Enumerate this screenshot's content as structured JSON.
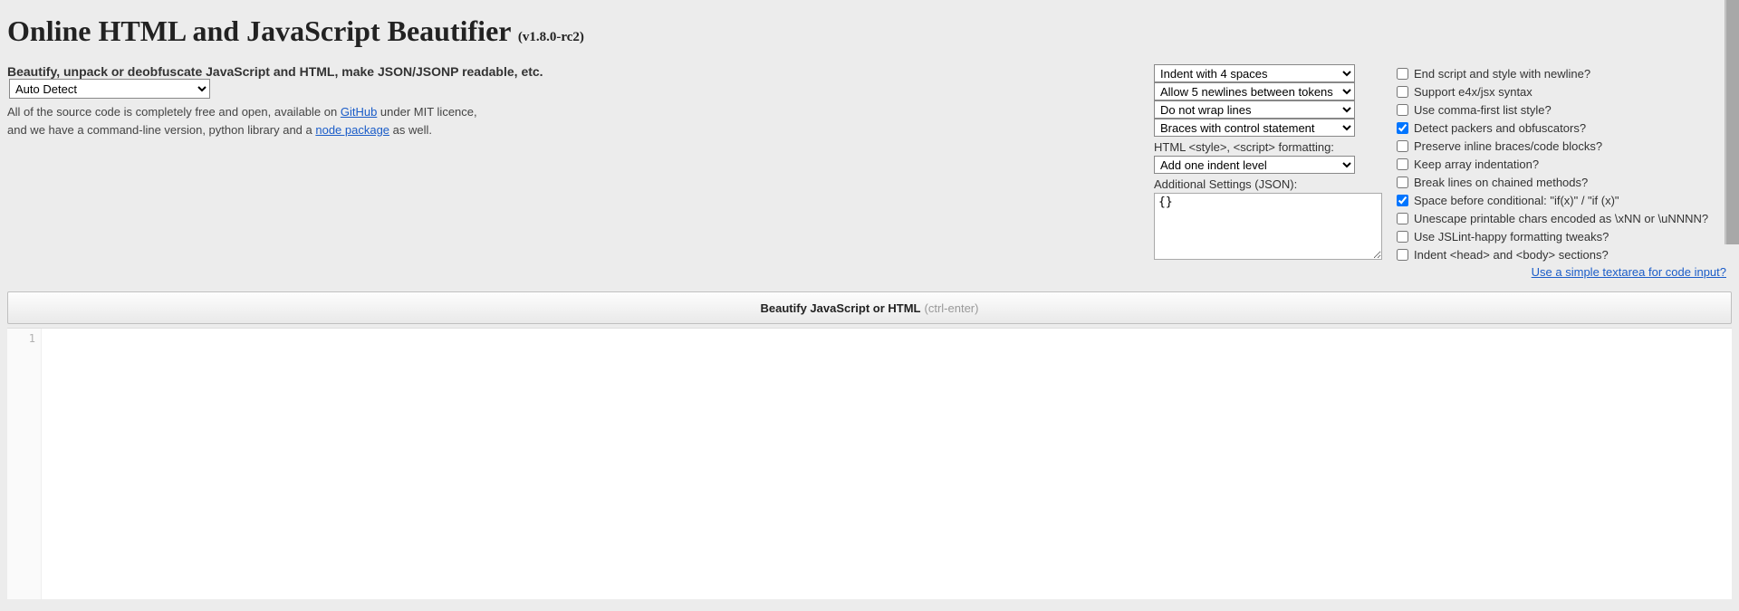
{
  "title": "Online HTML and JavaScript Beautifier",
  "version": "(v1.8.0-rc2)",
  "subtitle": "Beautify, unpack or deobfuscate JavaScript and HTML, make JSON/JSONP readable, etc.",
  "intro1_pre": "All of the source code is completely free and open, available on ",
  "intro1_link": "GitHub",
  "intro1_post": " under MIT licence,",
  "intro2_pre": "and we have a command-line version, python library and a ",
  "intro2_link": "node package",
  "intro2_post": " as well.",
  "langSelect": "Auto Detect",
  "mid": {
    "indent": "Indent with 4 spaces",
    "newlines": "Allow 5 newlines between tokens",
    "wrap": "Do not wrap lines",
    "braces": "Braces with control statement",
    "styleLabel": "HTML <style>, <script> formatting:",
    "styleSelect": "Add one indent level",
    "additionalLabel": "Additional Settings (JSON):",
    "additionalValue": "{}"
  },
  "checks": [
    {
      "label": "End script and style with newline?",
      "checked": false
    },
    {
      "label": "Support e4x/jsx syntax",
      "checked": false
    },
    {
      "label": "Use comma-first list style?",
      "checked": false
    },
    {
      "label": "Detect packers and obfuscators?",
      "checked": true
    },
    {
      "label": "Preserve inline braces/code blocks?",
      "checked": false
    },
    {
      "label": "Keep array indentation?",
      "checked": false
    },
    {
      "label": "Break lines on chained methods?",
      "checked": false
    },
    {
      "label": "Space before conditional: \"if(x)\" / \"if (x)\"",
      "checked": true
    },
    {
      "label": "Unescape printable chars encoded as \\xNN or \\uNNNN?",
      "checked": false
    },
    {
      "label": "Use JSLint-happy formatting tweaks?",
      "checked": false
    },
    {
      "label": "Indent <head> and <body> sections?",
      "checked": false
    }
  ],
  "textareaLink": "Use a simple textarea for code input?",
  "beautify": {
    "label": "Beautify JavaScript or HTML",
    "hint": "(ctrl-enter)"
  },
  "gutterLine": "1"
}
